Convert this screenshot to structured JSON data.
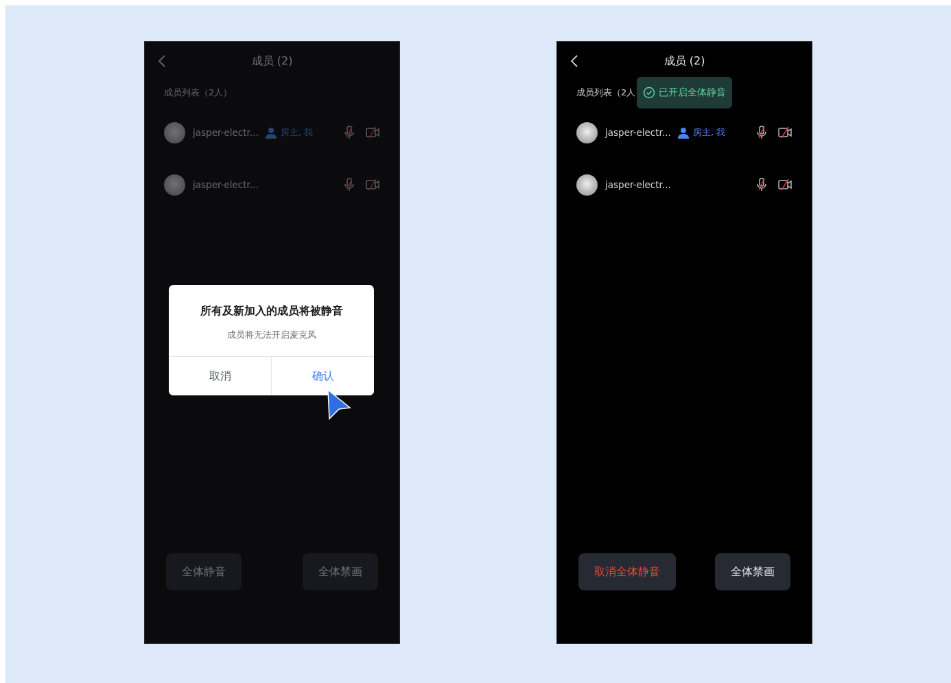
{
  "screens": [
    {
      "dimmed": true,
      "title": "成员 (2)",
      "list_header": "成员列表（2人）",
      "members": [
        {
          "name": "jasper-electr...",
          "role": "房主, 我",
          "mic_muted": true,
          "camera_off": true
        },
        {
          "name": "jasper-electr...",
          "mic_muted": true,
          "camera_off": true
        }
      ],
      "dialog": {
        "title": "所有及新加入的成员将被静音",
        "message": "成员将无法开启麦克风",
        "buttons": [
          {
            "label": "取消",
            "kind": "cancel"
          },
          {
            "label": "确认",
            "kind": "confirm"
          }
        ]
      },
      "actions": [
        {
          "label": "全体静音",
          "kind": "normal"
        },
        {
          "label": "全体禁画",
          "kind": "normal"
        }
      ]
    },
    {
      "dimmed": false,
      "title": "成员 (2)",
      "list_header": "成员列表（2人",
      "toast": "已开启全体静音",
      "members": [
        {
          "name": "jasper-electr...",
          "role": "房主, 我",
          "mic_muted": true,
          "camera_off": true
        },
        {
          "name": "jasper-electr...",
          "mic_muted": true,
          "camera_off": true
        }
      ],
      "actions": [
        {
          "label": "取消全体静音",
          "kind": "danger"
        },
        {
          "label": "全体禁画",
          "kind": "normal"
        }
      ]
    }
  ]
}
